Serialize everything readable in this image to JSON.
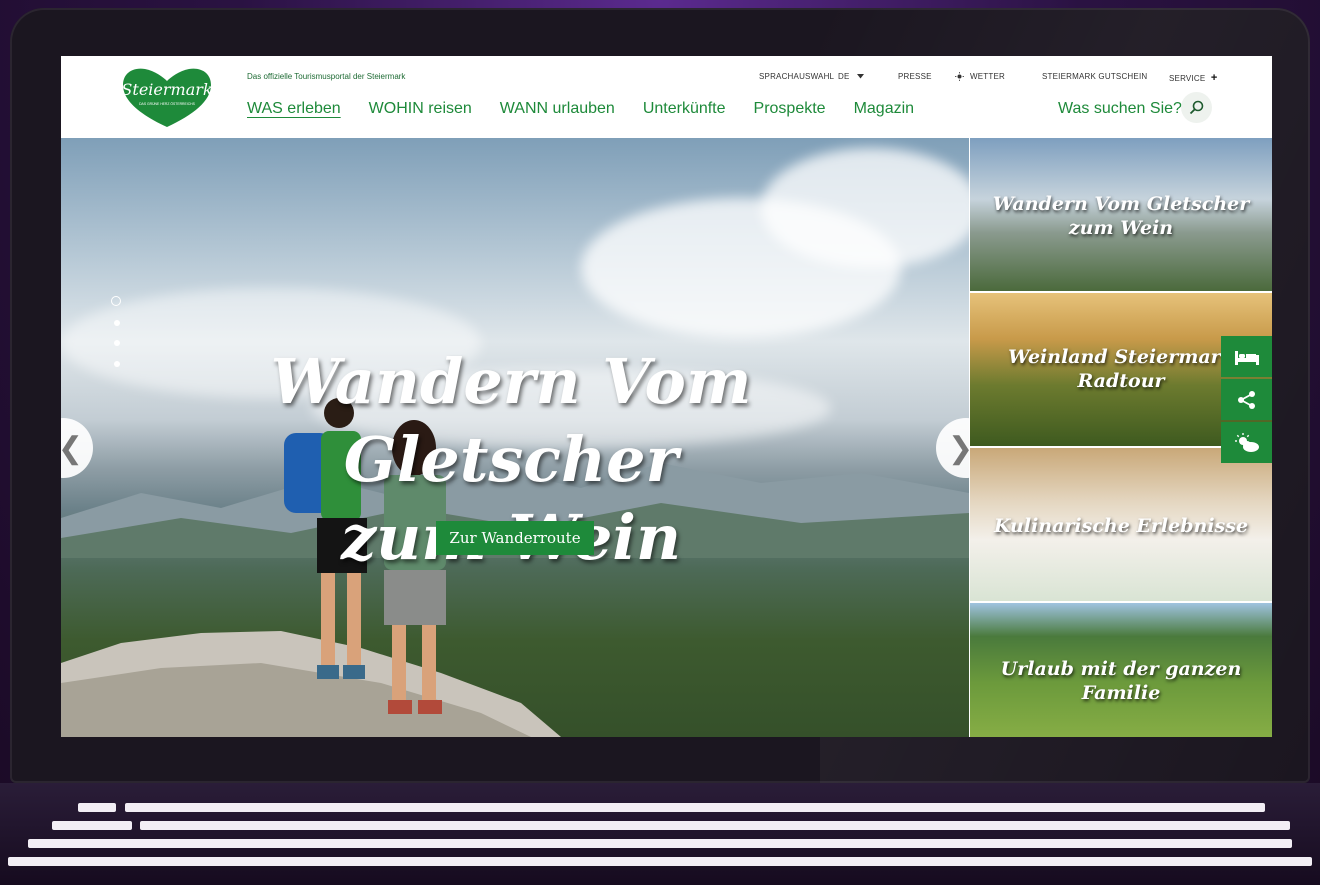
{
  "site": {
    "tagline": "Das offizielle Tourismusportal der Steiermark",
    "logo_text": "Steiermark",
    "logo_subtext": "DAS GRÜNE HERZ ÖSTERREICHS"
  },
  "utility_nav": {
    "language_label": "SPRACHAUSWAHL",
    "language_value": "DE",
    "presse": "PRESSE",
    "wetter": "WETTER",
    "gutschein": "STEIERMARK GUTSCHEIN",
    "service": "SERVICE",
    "service_plus": "+"
  },
  "main_nav": [
    {
      "label": "WAS erleben",
      "active": true
    },
    {
      "label": "WOHIN reisen",
      "active": false
    },
    {
      "label": "WANN urlauben",
      "active": false
    },
    {
      "label": "Unterkünfte",
      "active": false
    },
    {
      "label": "Prospekte",
      "active": false
    },
    {
      "label": "Magazin",
      "active": false
    }
  ],
  "search": {
    "label": "Was suchen Sie?"
  },
  "hero": {
    "title_line1": "Wandern Vom Gletscher",
    "title_line2": "zum Wein",
    "cta_label": "Zur Wanderroute",
    "slide_count": 4,
    "active_slide": 1,
    "prev_arrow": "❮",
    "next_arrow": "❯"
  },
  "tiles": [
    {
      "title": "Wandern Vom Gletscher zum Wein"
    },
    {
      "title": "Weinland Steiermark Radtour"
    },
    {
      "title": "Kulinarische Erlebnisse"
    },
    {
      "title": "Urlaub mit der ganzen Familie"
    }
  ],
  "floating_actions": [
    {
      "icon": "bed-icon"
    },
    {
      "icon": "share-icon"
    },
    {
      "icon": "weather-icon"
    }
  ],
  "colors": {
    "brand_green": "#1e8a3a",
    "frame": "#1b1620",
    "backdrop": "#2a1242"
  }
}
